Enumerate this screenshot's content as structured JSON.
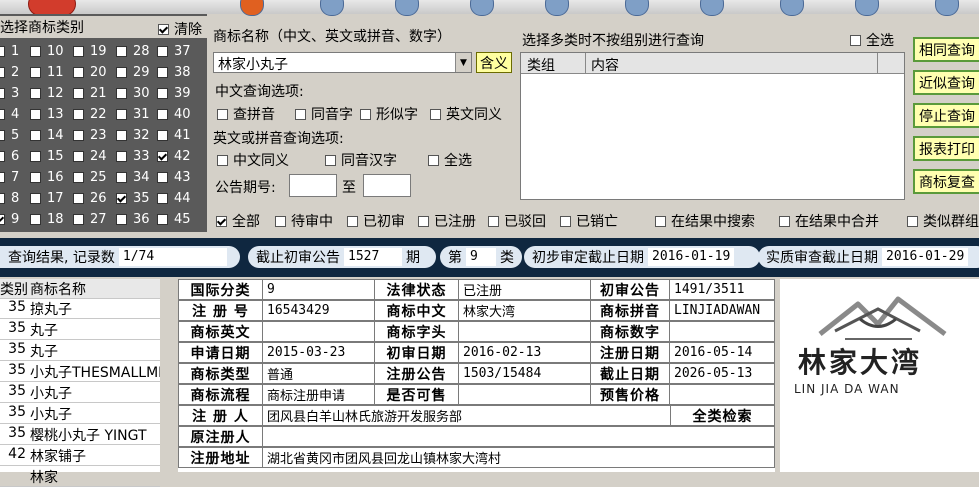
{
  "category_panel": {
    "title": "选择商标类别",
    "clear_label": "清除",
    "columns": [
      [
        {
          "n": "1",
          "c": false
        },
        {
          "n": "2",
          "c": false
        },
        {
          "n": "3",
          "c": false
        },
        {
          "n": "4",
          "c": false
        },
        {
          "n": "5",
          "c": false
        },
        {
          "n": "6",
          "c": false
        },
        {
          "n": "7",
          "c": false
        },
        {
          "n": "8",
          "c": false
        },
        {
          "n": "9",
          "c": true
        }
      ],
      [
        {
          "n": "10",
          "c": false
        },
        {
          "n": "11",
          "c": false
        },
        {
          "n": "12",
          "c": false
        },
        {
          "n": "13",
          "c": false
        },
        {
          "n": "14",
          "c": false
        },
        {
          "n": "15",
          "c": false
        },
        {
          "n": "16",
          "c": false
        },
        {
          "n": "17",
          "c": false
        },
        {
          "n": "18",
          "c": false
        }
      ],
      [
        {
          "n": "19",
          "c": false
        },
        {
          "n": "20",
          "c": false
        },
        {
          "n": "21",
          "c": false
        },
        {
          "n": "22",
          "c": false
        },
        {
          "n": "23",
          "c": false
        },
        {
          "n": "24",
          "c": false
        },
        {
          "n": "25",
          "c": false
        },
        {
          "n": "26",
          "c": false
        },
        {
          "n": "27",
          "c": false
        }
      ],
      [
        {
          "n": "28",
          "c": false
        },
        {
          "n": "29",
          "c": false
        },
        {
          "n": "30",
          "c": false
        },
        {
          "n": "31",
          "c": false
        },
        {
          "n": "32",
          "c": false
        },
        {
          "n": "33",
          "c": false
        },
        {
          "n": "34",
          "c": false
        },
        {
          "n": "35",
          "c": true
        },
        {
          "n": "36",
          "c": false
        }
      ],
      [
        {
          "n": "37",
          "c": false
        },
        {
          "n": "38",
          "c": false
        },
        {
          "n": "39",
          "c": false
        },
        {
          "n": "40",
          "c": false
        },
        {
          "n": "41",
          "c": false
        },
        {
          "n": "42",
          "c": true
        },
        {
          "n": "43",
          "c": false
        },
        {
          "n": "44",
          "c": false
        },
        {
          "n": "45",
          "c": false
        }
      ]
    ]
  },
  "search": {
    "name_label": "商标名称（中文、英文或拼音、数字）",
    "name_value": "林家小丸子",
    "meaning_button": "含义",
    "cn_options_label": "中文查询选项:",
    "cn_options": [
      "查拼音",
      "同音字",
      "形似字",
      "英文同义"
    ],
    "en_options_label": "英文或拼音查询选项:",
    "en_options": [
      "中文同义",
      "同音汉字",
      "全选"
    ],
    "gazette_label": "公告期号:",
    "gazette_to": "至"
  },
  "multi": {
    "label": "选择多类时不按组别进行查询",
    "select_all": "全选",
    "col_group": "类组",
    "col_content": "内容"
  },
  "actions": [
    "相同查询",
    "近似查询",
    "停止查询",
    "报表打印",
    "商标复查"
  ],
  "status_filters": [
    {
      "label": "全部",
      "checked": true
    },
    {
      "label": "待审中",
      "checked": false
    },
    {
      "label": "已初审",
      "checked": false
    },
    {
      "label": "已注册",
      "checked": false
    },
    {
      "label": "已驳回",
      "checked": false
    },
    {
      "label": "已销亡",
      "checked": false
    }
  ],
  "result_filters": [
    "在结果中搜索",
    "在结果中合并",
    "类似群组"
  ],
  "result_bar": {
    "query_label": "查询结果, 记录数",
    "count": "1/74",
    "cutoff_label": "截止初审公告",
    "cutoff_value": "1527",
    "cutoff_unit": "期",
    "class_prefix": "第",
    "class_value": "9",
    "class_unit": "类",
    "prelim_label": "初步审定截止日期",
    "prelim_value": "2016-01-19",
    "subst_label": "实质审查截止日期",
    "subst_value": "2016-01-29"
  },
  "list": {
    "col_class": "类别",
    "col_name": "商标名称",
    "rows": [
      {
        "cls": "35",
        "name": "掠丸子"
      },
      {
        "cls": "35",
        "name": "丸子"
      },
      {
        "cls": "35",
        "name": "丸子"
      },
      {
        "cls": "35",
        "name": "小丸子THESMALLME"
      },
      {
        "cls": "35",
        "name": "小丸子"
      },
      {
        "cls": "35",
        "name": "小丸子"
      },
      {
        "cls": "35",
        "name": "樱桃小丸子 YINGT"
      },
      {
        "cls": "42",
        "name": "林家铺子"
      },
      {
        "cls": "",
        "name": "林家"
      }
    ]
  },
  "detail": {
    "intl_class_label": "国际分类",
    "intl_class": "9",
    "legal_status_label": "法律状态",
    "legal_status": "已注册",
    "prelim_gazette_label": "初审公告",
    "prelim_gazette": "1491/3511",
    "reg_no_label": "注 册 号",
    "reg_no": "16543429",
    "cn_name_label": "商标中文",
    "cn_name": "林家大湾",
    "pinyin_label": "商标拼音",
    "pinyin": "LINJIADAWAN",
    "en_label": "商标英文",
    "en": "",
    "letters_label": "商标字头",
    "letters": "",
    "digits_label": "商标数字",
    "digits": "",
    "apply_date_label": "申请日期",
    "apply_date": "2015-03-23",
    "prelim_date_label": "初审日期",
    "prelim_date": "2016-02-13",
    "reg_date_label": "注册日期",
    "reg_date": "2016-05-14",
    "type_label": "商标类型",
    "type": "普通",
    "reg_gazette_label": "注册公告",
    "reg_gazette": "1503/15484",
    "expire_label": "截止日期",
    "expire": "2026-05-13",
    "flow_label": "商标流程",
    "flow": "商标注册申请",
    "shared_label": "是否可售",
    "shared": "",
    "price_label": "预售价格",
    "price": "",
    "registrant_label": "注 册 人",
    "registrant": "团风县白羊山林氏旅游开发服务部",
    "all_search": "全类检索",
    "orig_registrant_label": "原注册人",
    "orig_registrant": "",
    "address_label": "注册地址",
    "address": "湖北省黄冈市团风县回龙山镇林家大湾村"
  },
  "logo": {
    "name_cn": "林家大湾",
    "name_pinyin": "LIN JIA DA WAN"
  }
}
